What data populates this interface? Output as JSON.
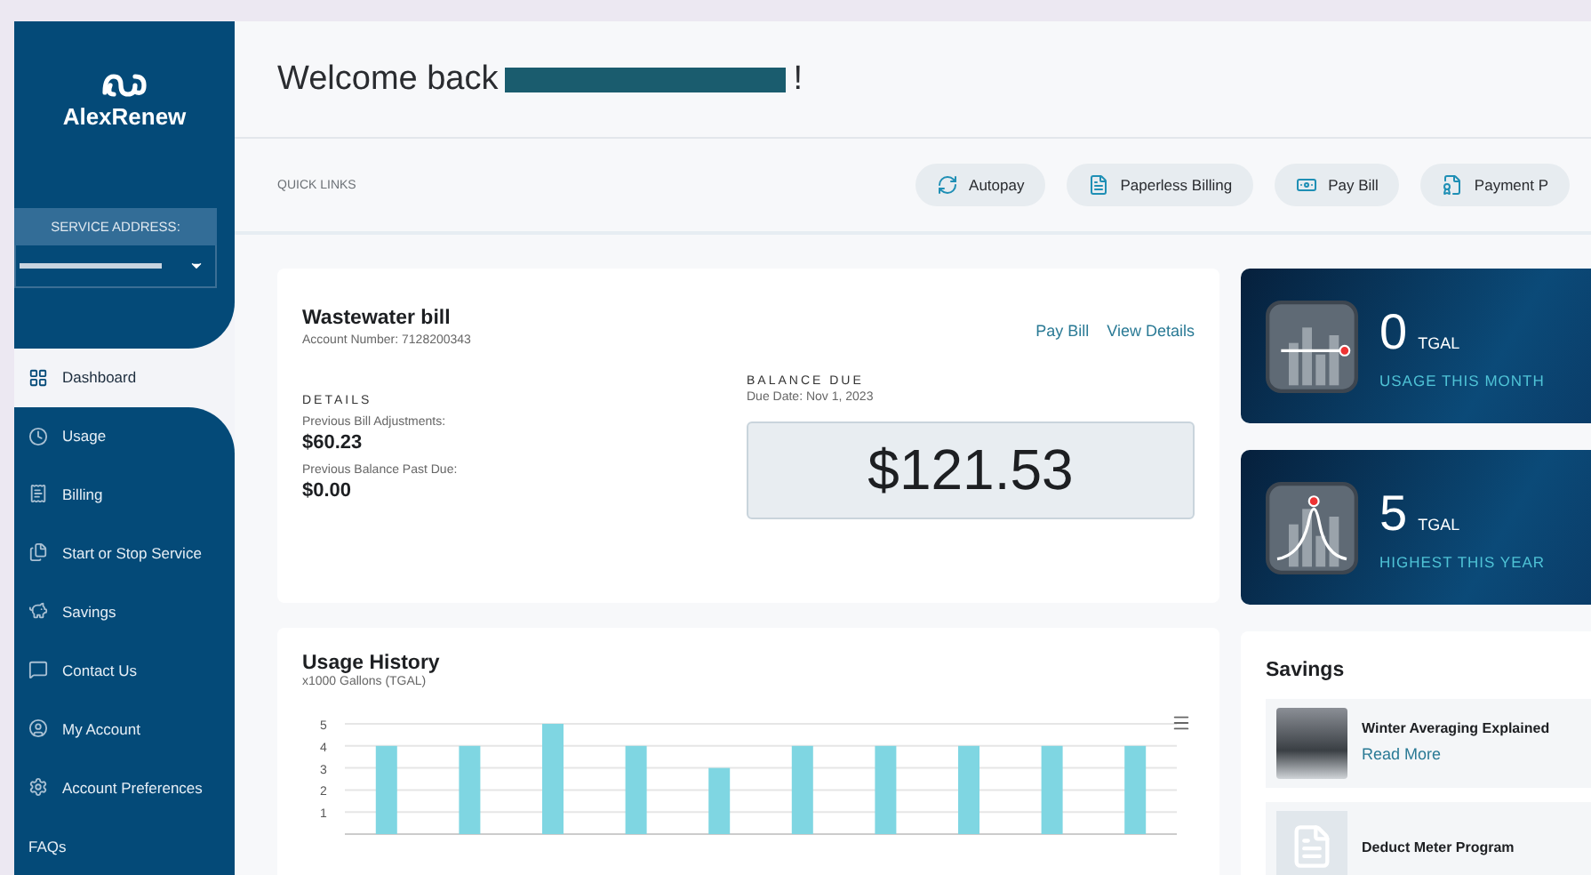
{
  "brand": {
    "name": "AlexRenew"
  },
  "service_address": {
    "label": "SERVICE ADDRESS:",
    "redacted": true
  },
  "nav": [
    {
      "label": "Dashboard",
      "selected": true
    },
    {
      "label": "Usage",
      "selected": false
    },
    {
      "label": "Billing",
      "selected": false
    },
    {
      "label": "Start or Stop Service",
      "selected": false
    },
    {
      "label": "Savings",
      "selected": false
    },
    {
      "label": "Contact Us",
      "selected": false
    },
    {
      "label": "My Account",
      "selected": false
    },
    {
      "label": "Account Preferences",
      "selected": false
    },
    {
      "label": "FAQs",
      "selected": false
    }
  ],
  "header": {
    "greeting": "Welcome back",
    "name_redacted": true,
    "punctuation": "!"
  },
  "quick_links": {
    "label": "QUICK LINKS",
    "items": [
      "Autopay",
      "Paperless Billing",
      "Pay Bill",
      "Payment P"
    ]
  },
  "bill": {
    "title": "Wastewater bill",
    "account": "Account Number: 7128200343",
    "actions": [
      "Pay Bill",
      "View Details"
    ],
    "details_label": "DETAILS",
    "details": [
      {
        "label": "Previous Bill Adjustments:",
        "value": "$60.23"
      },
      {
        "label": "Previous Balance Past Due:",
        "value": "$0.00"
      }
    ],
    "balance_label": "BALANCE DUE",
    "due_date": "Due Date: Nov 1, 2023",
    "balance": "$121.53"
  },
  "stats": [
    {
      "kind": "flat",
      "value": "0",
      "unit": "TGAL",
      "label": "USAGE THIS MONTH"
    },
    {
      "kind": "peak",
      "value": "5",
      "unit": "TGAL",
      "label": "HIGHEST THIS YEAR"
    }
  ],
  "usage_history": {
    "title": "Usage History",
    "subtitle": "x1000 Gallons (TGAL)",
    "chart_data": {
      "type": "bar",
      "values": [
        4,
        4,
        5,
        4,
        3,
        4,
        4,
        4,
        4,
        4
      ],
      "ylim": [
        0,
        5
      ],
      "yticks": [
        1,
        2,
        3,
        4,
        5
      ],
      "grid": true
    }
  },
  "savings": {
    "title": "Savings",
    "items": [
      {
        "kind": "photo",
        "title": "Winter Averaging Explained",
        "link": "Read More"
      },
      {
        "kind": "document",
        "title": "Deduct Meter Program"
      }
    ]
  }
}
